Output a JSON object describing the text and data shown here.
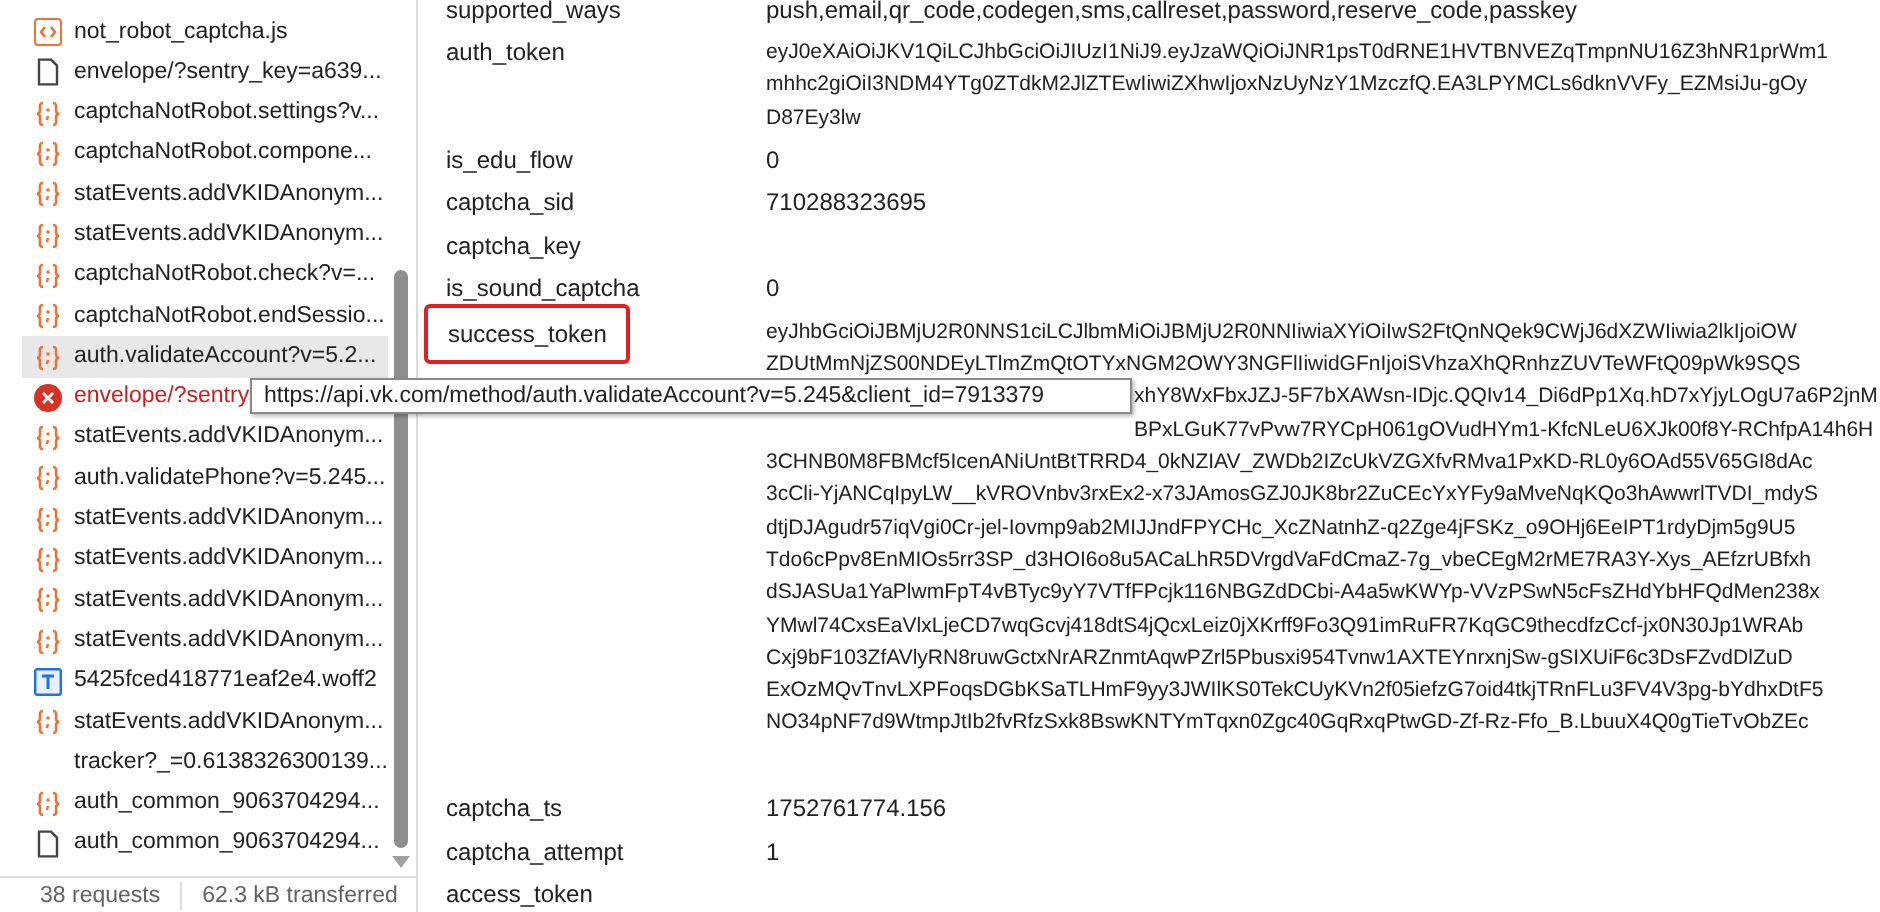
{
  "requests": [
    {
      "name": "not_robot_captcha.js",
      "kind": "script",
      "selected": false
    },
    {
      "name": "envelope/?sentry_key=a639...",
      "kind": "document",
      "selected": false
    },
    {
      "name": "captchaNotRobot.settings?v...",
      "kind": "fetch",
      "selected": false
    },
    {
      "name": "captchaNotRobot.compone...",
      "kind": "fetch",
      "selected": false
    },
    {
      "name": "statEvents.addVKIDAnonym...",
      "kind": "fetch",
      "selected": false
    },
    {
      "name": "statEvents.addVKIDAnonym...",
      "kind": "fetch",
      "selected": false
    },
    {
      "name": "captchaNotRobot.check?v=...",
      "kind": "fetch",
      "selected": false
    },
    {
      "name": "captchaNotRobot.endSessio...",
      "kind": "fetch",
      "selected": false
    },
    {
      "name": "auth.validateAccount?v=5.2...",
      "kind": "fetch",
      "selected": true
    },
    {
      "name": "envelope/?sentry",
      "kind": "error",
      "selected": false
    },
    {
      "name": "statEvents.addVKIDAnonym...",
      "kind": "fetch",
      "selected": false
    },
    {
      "name": "auth.validatePhone?v=5.245...",
      "kind": "fetch",
      "selected": false
    },
    {
      "name": "statEvents.addVKIDAnonym...",
      "kind": "fetch",
      "selected": false
    },
    {
      "name": "statEvents.addVKIDAnonym...",
      "kind": "fetch",
      "selected": false
    },
    {
      "name": "statEvents.addVKIDAnonym...",
      "kind": "fetch",
      "selected": false
    },
    {
      "name": "statEvents.addVKIDAnonym...",
      "kind": "fetch",
      "selected": false
    },
    {
      "name": "5425fced418771eaf2e4.woff2",
      "kind": "font",
      "selected": false
    },
    {
      "name": "statEvents.addVKIDAnonym...",
      "kind": "fetch",
      "selected": false
    },
    {
      "name": "tracker?_=0.6138326300139...",
      "kind": "other",
      "selected": false
    },
    {
      "name": "auth_common_9063704294...",
      "kind": "fetch",
      "selected": false
    },
    {
      "name": "auth_common_9063704294...",
      "kind": "document",
      "selected": false
    }
  ],
  "status_bar": {
    "requests": "38 requests",
    "transferred": "62.3 kB transferred"
  },
  "tooltip": "https://api.vk.com/method/auth.validateAccount?v=5.245&client_id=7913379",
  "fields": [
    {
      "key": "supported_ways",
      "highlighted": false,
      "lines": [
        {
          "text": "push,email,qr_code,codegen,sms,callreset,password,reserve_code,passkey",
          "covered": false
        }
      ]
    },
    {
      "key": "auth_token",
      "highlighted": false,
      "lines": [
        {
          "text": "eyJ0eXAiOiJKV1QiLCJhbGciOiJIUzI1NiJ9.eyJzaWQiOiJNR1psT0dRNE1HVTBNVEZqTmpnNU16Z3hNR1prWm1",
          "covered": false
        },
        {
          "text": "mhhc2giOiI3NDM4YTg0ZTdkM2JlZTEwIiwiZXhwIjoxNzUyNzY1MzczfQ.EA3LPYMCLs6dknVVFy_EZMsiJu-gOy",
          "covered": false
        },
        {
          "text": "D87Ey3lw",
          "covered": false
        }
      ]
    },
    {
      "key": "is_edu_flow",
      "highlighted": false,
      "lines": [
        {
          "text": "0",
          "covered": false
        }
      ]
    },
    {
      "key": "captcha_sid",
      "highlighted": false,
      "lines": [
        {
          "text": "710288323695",
          "covered": false
        }
      ]
    },
    {
      "key": "captcha_key",
      "highlighted": false
    },
    {
      "key": "is_sound_captcha",
      "highlighted": false,
      "lines": [
        {
          "text": "0",
          "covered": false
        }
      ]
    },
    {
      "key": "success_token",
      "highlighted": true,
      "lines": [
        {
          "text": "eyJhbGciOiJBMjU2R0NNS1ciLCJlbmMiOiJBMjU2R0NNIiwiaXYiOiIwS2FtQnNQek9CWjJ6dXZWIiwia2lkIjoiOW",
          "covered": false
        },
        {
          "text": "ZDUtMmNjZS00NDEyLTlmZmQtOTYxNGM2OWY3NGFlIiwidGFnIjoiSVhzaXhQRnhzZUVTeWFtQ09pWk9SQS",
          "covered": false
        },
        {
          "text": "xhY8WxFbxJZJ-5F7bXAWsn-IDjc.QQIv14_Di6dPp1Xq.hD7xYjyLOgU7a6P2jnM",
          "covered": true
        },
        {
          "text": "BPxLGuK77vPvw7RYCpH061gOVudHYm1-KfcNLeU6XJk00f8Y-RChfpA14h6H",
          "covered": true
        },
        {
          "text": "3CHNB0M8FBMcf5IcenANiUntBtTRRD4_0kNZIAV_ZWDb2IZcUkVZGXfvRMva1PxKD-RL0y6OAd55V65GI8dAc",
          "covered": false
        },
        {
          "text": "3cCli-YjANCqIpyLW__kVROVnbv3rxEx2-x73JAmosGZJ0JK8br2ZuCEcYxYFy9aMveNqKQo3hAwwrlTVDI_mdyS",
          "covered": false
        },
        {
          "text": "dtjDJAgudr57iqVgi0Cr-jel-Iovmp9ab2MIJJndFPYCHc_XcZNatnhZ-q2Zge4jFSKz_o9OHj6EeIPT1rdyDjm5g9U5",
          "covered": false
        },
        {
          "text": "Tdo6cPpv8EnMIOs5rr3SP_d3HOI6o8u5ACaLhR5DVrgdVaFdCmaZ-7g_vbeCEgM2rME7RA3Y-Xys_AEfzrUBfxh",
          "covered": false
        },
        {
          "text": "dSJASUa1YaPlwmFpT4vBTyc9yY7VTfFPcjk116NBGZdDCbi-A4a5wKWYp-VVzPSwN5cFsZHdYbHFQdMen238x",
          "covered": false
        },
        {
          "text": "YMwl74CxsEaVlxLjeCD7wqGcvj418dtS4jQcxLeiz0jXKrff9Fo3Q91imRuFR7KqGC9thecdfzCcf-jx0N30Jp1WRAb",
          "covered": false
        },
        {
          "text": "Cxj9bF103ZfAVlyRN8ruwGctxNrARZnmtAqwPZrl5Pbusxi954Tvnw1AXTEYnrxnjSw-gSIXUiF6c3DsFZvdDlZuD",
          "covered": false
        },
        {
          "text": "ExOzMQvTnvLXPFoqsDGbKSaTLHmF9yy3JWIlKS0TekCUyKVn2f05iefzG7oid4tkjTRnFLu3FV4V3pg-bYdhxDtF5",
          "covered": false
        },
        {
          "text": "NO34pNF7d9WtmpJtIb2fvRfzSxk8BswKNTYmTqxn0Zgc40GqRxqPtwGD-Zf-Rz-Ffo_B.LbuuX4Q0gTieTvObZEc",
          "covered": false
        }
      ]
    },
    {
      "key": "captcha_ts",
      "highlighted": false,
      "lines": [
        {
          "text": "1752761774.156",
          "covered": false
        }
      ]
    },
    {
      "key": "captcha_attempt",
      "highlighted": false,
      "lines": [
        {
          "text": "1",
          "covered": false
        }
      ]
    },
    {
      "key": "access_token",
      "highlighted": false
    }
  ]
}
